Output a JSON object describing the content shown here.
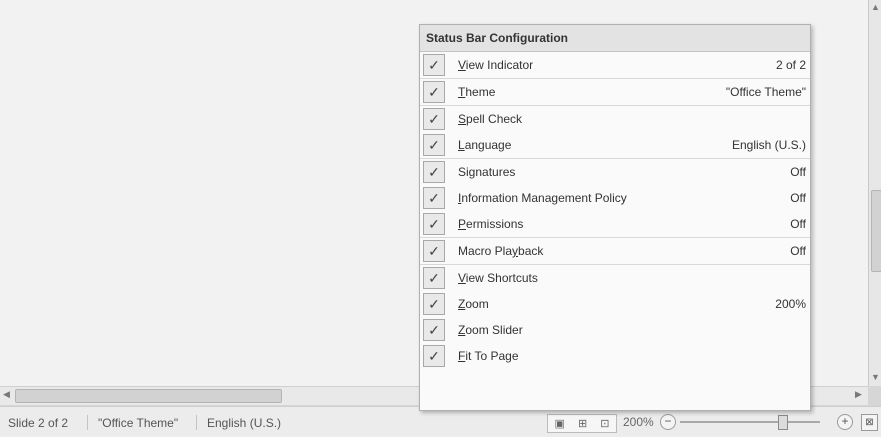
{
  "menu": {
    "title": "Status Bar Configuration",
    "items": [
      {
        "first": "V",
        "rest": "iew Indicator",
        "value": "2 of 2"
      },
      {
        "first": "T",
        "rest": "heme",
        "value": "\"Office Theme\""
      },
      {
        "first": "S",
        "rest": "pell Check",
        "value": ""
      },
      {
        "first": "L",
        "rest": "anguage",
        "value": "English (U.S.)"
      },
      {
        "first": "Si",
        "mid": "g",
        "rest": "natures",
        "value": "Off"
      },
      {
        "first": "I",
        "rest": "nformation Management Policy",
        "value": "Off"
      },
      {
        "first": "P",
        "rest": "ermissions",
        "value": "Off"
      },
      {
        "first": "Macro Pla",
        "mid": "y",
        "rest": "back",
        "value": "Off"
      },
      {
        "first": "V",
        "rest": "iew Shortcuts",
        "value": ""
      },
      {
        "first": "Z",
        "rest": "oom",
        "value": "200%"
      },
      {
        "first": "Z",
        "rest": "oom Slider",
        "value": ""
      },
      {
        "first": "F",
        "rest": "it To Page",
        "value": ""
      }
    ]
  },
  "statusbar": {
    "slide": "Slide 2 of 2",
    "theme": "\"Office Theme\"",
    "language": "English (U.S.)",
    "zoom": "200%"
  },
  "icons": {
    "check": "checkmark-icon",
    "zoom_out": "minus-icon",
    "zoom_in": "plus-icon",
    "fit": "fit-window-icon"
  }
}
